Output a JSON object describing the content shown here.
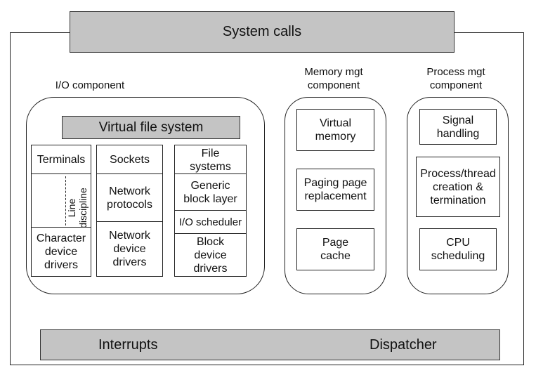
{
  "system_calls": "System calls",
  "io": {
    "label": "I/O component",
    "vfs": "Virtual file system",
    "terminals": "Terminals",
    "line_discipline": "Line discipline",
    "char_drivers": "Character device drivers",
    "sockets": "Sockets",
    "net_protocols": "Network protocols",
    "net_drivers": "Network device drivers",
    "file_systems": "File systems",
    "generic_block": "Generic block layer",
    "io_scheduler": "I/O scheduler",
    "block_drivers": "Block device drivers"
  },
  "memory": {
    "label": "Memory mgt component",
    "virtual_memory": "Virtual memory",
    "paging": "Paging page replacement",
    "page_cache": "Page cache"
  },
  "process": {
    "label": "Process mgt component",
    "signal": "Signal handling",
    "thread": "Process/thread creation & termination",
    "cpu": "CPU scheduling"
  },
  "bottom": {
    "interrupts": "Interrupts",
    "dispatcher": "Dispatcher"
  },
  "colors": {
    "bar_fill": "#c4c4c4"
  }
}
